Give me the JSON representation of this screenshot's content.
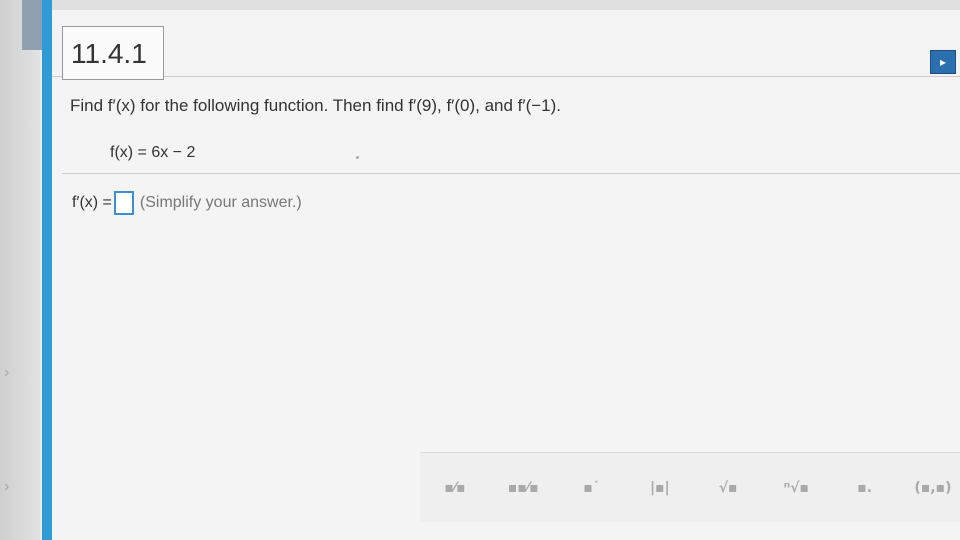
{
  "header": {
    "question_number": "11.4.1",
    "nav_icon": "next-arrow-icon"
  },
  "question": {
    "prompt": "Find f′(x) for the following function. Then find f′(9), f′(0), and f′(−1).",
    "function": "f(x) = 6x − 2"
  },
  "answer": {
    "label": "f′(x) =",
    "value": "",
    "hint": "(Simplify your answer.)"
  },
  "toolbar": {
    "buttons": [
      {
        "name": "fraction-icon",
        "glyph": "▪⁄▪"
      },
      {
        "name": "mixed-number-icon",
        "glyph": "▪▪⁄▪"
      },
      {
        "name": "exponent-icon",
        "glyph": "▪˙"
      },
      {
        "name": "absolute-value-icon",
        "glyph": "|▪|"
      },
      {
        "name": "square-root-icon",
        "glyph": "√▪"
      },
      {
        "name": "nth-root-icon",
        "glyph": "ⁿ√▪"
      },
      {
        "name": "decimal-icon",
        "glyph": "▪."
      },
      {
        "name": "ordered-pair-icon",
        "glyph": "(▪,▪)"
      }
    ]
  }
}
